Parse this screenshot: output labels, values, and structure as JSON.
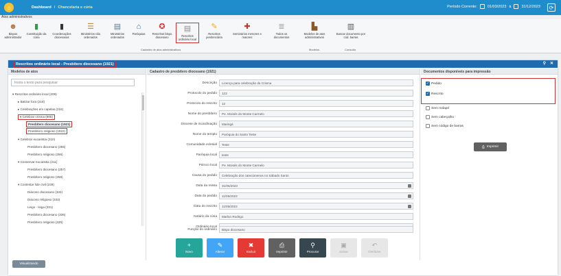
{
  "topbar": {
    "crumb1": "Dashboard",
    "sep": "/",
    "crumb2": "Chancelaria e cúria",
    "period_label": "Período Corrente:",
    "date_from": "01/03/2023",
    "to": "à",
    "date_to": "31/12/2023"
  },
  "atos_title": "Atos administrativos",
  "ribbon": {
    "items": [
      {
        "label": "Bispos administrador",
        "icon": "person-icon"
      },
      {
        "label": "Constituição da cúria",
        "icon": "book-green-icon"
      },
      {
        "label": "Coordenações diocesanas",
        "icon": "book-dark-icon"
      },
      {
        "label": "Ministérios não ordenados",
        "icon": "documents-icon"
      },
      {
        "label": "Ministérios ordenados",
        "icon": "document-person-icon"
      },
      {
        "label": "Paróquias",
        "icon": "church-icon"
      },
      {
        "label": "Rescritos bispo diocesano",
        "icon": "seal-icon"
      },
      {
        "label": "Rescritos ordinário local",
        "icon": "scroll-icon"
      },
      {
        "label": "Rescritos penitenciária",
        "icon": "pen-icon"
      },
      {
        "label": "Seminários menores e maiores",
        "icon": "seminary-icon"
      },
      {
        "label": "Todos os documentos",
        "icon": "stack-icon"
      },
      {
        "label": "Modelos de atos administrativos",
        "icon": "stamp-icon"
      },
      {
        "label": "Buscar documento por cód. barras",
        "icon": "barcode-icon"
      }
    ],
    "group1": "Cadastro de atos administrativos",
    "group2": "Modelos",
    "group3": "Consulta"
  },
  "panel_title": "Rescritos ordinário local - Presbítero diocesano (1921)",
  "left": {
    "header": "Modelos de atos",
    "search_placeholder": "Insira o texto para pesquisar",
    "tree": [
      "▾  Rescritos ordinário local (209)",
      "▸  Batizar fora (218)",
      "▸  Celebrações em capelas (215)",
      "▾  Celebrar crisma (805)",
      "Presbítero diocesano (1921)",
      "Presbítero religioso (1922)",
      "▾  Celebrar eucaristia (210)",
      "Presbítero diocesano (255)",
      "Presbítero religioso (256)",
      "▾  Conservar eucaristia (211)",
      "Presbítero diocesano (257)",
      "Presbítero religioso (258)",
      "▾  Contestar lide civil (229)",
      "Diácono diocesano (334)",
      "Diácono religioso (333)",
      "Leigo - leiga (331)",
      "Presbítero diocesano (336)",
      "Presbítero religioso (335)"
    ]
  },
  "middle": {
    "header": "Cadastro de presbítero diocesano (1921)",
    "fields": [
      {
        "label": "Descrição",
        "value": "Licença para celebração da Crisma"
      },
      {
        "label": "Protocolo do pedido",
        "value": "123"
      },
      {
        "label": "Protocolo do rescrito",
        "value": "12"
      },
      {
        "label": "Nome do presbítero",
        "value": "Pe. Moisés do Monte Carmelo"
      },
      {
        "label": "Diocese de incardinação",
        "value": "Maringá"
      },
      {
        "label": "Nome do templo",
        "value": "Paróquia do Santo Teste"
      },
      {
        "label": "Comunidade eclesial",
        "value": "Teste"
      },
      {
        "label": "Paróquia local",
        "value": "teste"
      },
      {
        "label": "Pároco local",
        "value": "Pe. Moisés do Monte Carmelo"
      },
      {
        "label": "Causa do pedido",
        "value": "Celebração dos catecúmenos no Sábado Santo"
      },
      {
        "label": "Data da missa",
        "value": "31/05/2023"
      },
      {
        "label": "Data do pedido",
        "value": "11/05/2023"
      },
      {
        "label": "Data do rescrito",
        "value": "11/05/2023"
      },
      {
        "label": "Notário da cúria",
        "value": "Marlon Rodrigo"
      },
      {
        "label": "Ordinário local",
        "value": "Dom Roberto"
      },
      {
        "label": "Função do ordinário",
        "value": "Bispo diocesano"
      }
    ]
  },
  "buttons": {
    "novo": "Novo",
    "alterar": "Alterar",
    "excluir": "Excluir",
    "imprimir": "Imprimir",
    "procurar": "Procurar",
    "salvar": "Salvar",
    "desfazer": "Desfazer"
  },
  "right": {
    "header": "Documentos disponíveis para impressão",
    "pedido": "Pedido",
    "rescrito": "Rescrito",
    "sem_rodape": "Sem rodapé",
    "sem_cabecalho": "Sem cabeçalho",
    "sem_codigo": "Sem código de barras",
    "print": "Imprimir"
  },
  "visualizando": "Visualizando",
  "colors": {
    "primary": "#1f8ccc",
    "panel": "#1f6bb0",
    "highlight": "#d32f2f"
  }
}
